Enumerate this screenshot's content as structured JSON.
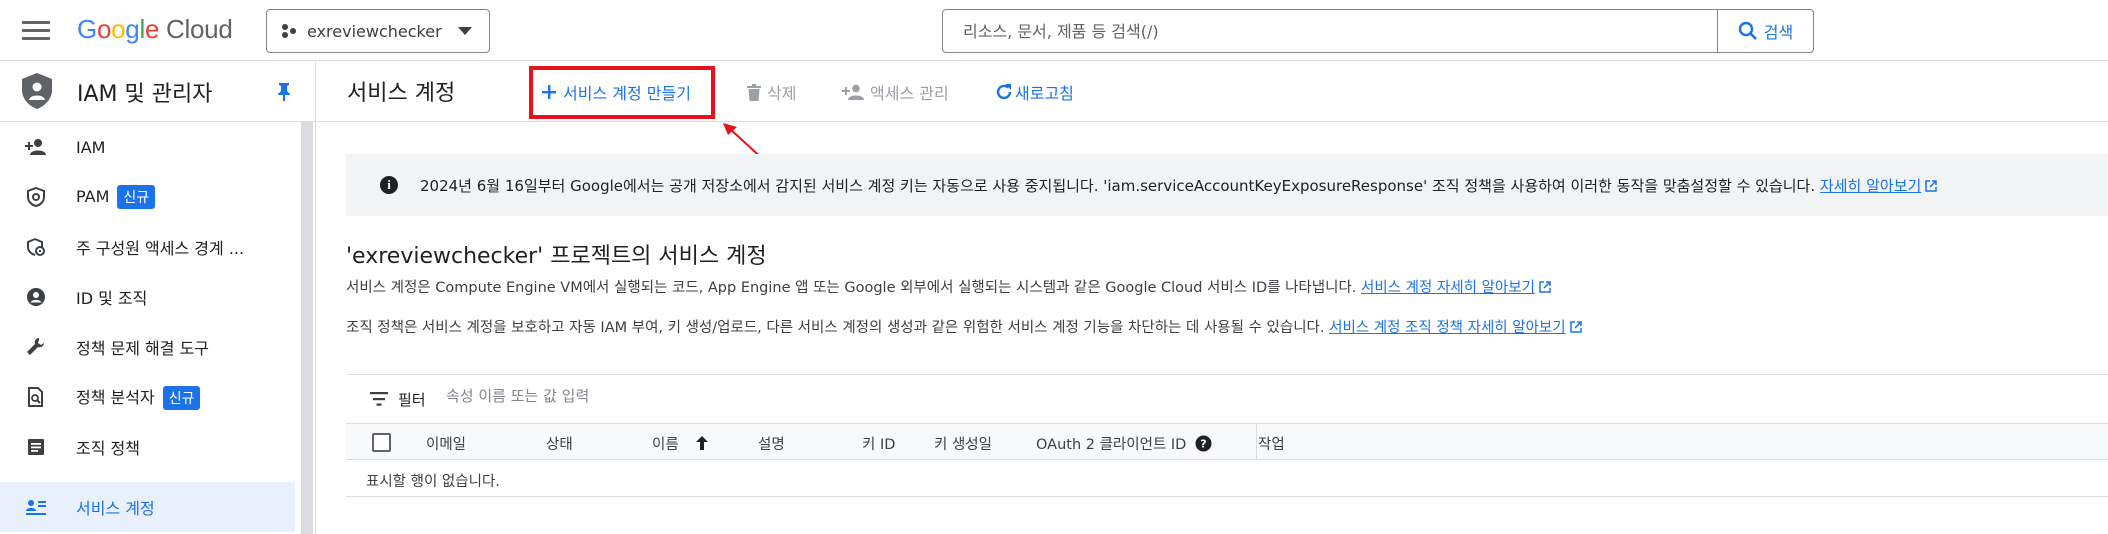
{
  "topbar": {
    "logo_google": "Google",
    "logo_cloud": "Cloud",
    "project_name": "exreviewchecker",
    "search_placeholder": "리소스, 문서, 제품 등 검색(/)",
    "search_button": "검색"
  },
  "product": {
    "title": "IAM 및 관리자"
  },
  "sidebar": {
    "items": [
      {
        "label": "IAM",
        "icon": "person-add-icon",
        "badge": ""
      },
      {
        "label": "PAM",
        "icon": "shield-gear-icon",
        "badge": "신규"
      },
      {
        "label": "주 구성원 액세스 경계 ...",
        "icon": "boundary-icon",
        "badge": ""
      },
      {
        "label": "ID 및 조직",
        "icon": "account-circle-icon",
        "badge": ""
      },
      {
        "label": "정책 문제 해결 도구",
        "icon": "wrench-icon",
        "badge": ""
      },
      {
        "label": "정책 분석자",
        "icon": "document-search-icon",
        "badge": "신규"
      },
      {
        "label": "조직 정책",
        "icon": "list-document-icon",
        "badge": ""
      },
      {
        "label": "서비스 계정",
        "icon": "service-account-icon",
        "badge": "",
        "active": true
      }
    ]
  },
  "toolbar": {
    "page_title": "서비스 계정",
    "create_label": "서비스 계정 만들기",
    "delete_label": "삭제",
    "access_label": "액세스 관리",
    "refresh_label": "새로고침"
  },
  "banner": {
    "text": "2024년 6월 16일부터 Google에서는 공개 저장소에서 감지된 서비스 계정 키는 자동으로 사용 중지됩니다. 'iam.serviceAccountKeyExposureResponse' 조직 정책을 사용하여 이러한 동작을 맞춤설정할 수 있습니다.",
    "link": "자세히 알아보기"
  },
  "section": {
    "title": "'exreviewchecker' 프로젝트의 서비스 계정",
    "desc1": "서비스 계정은 Compute Engine VM에서 실행되는 코드, App Engine 앱 또는 Google 외부에서 실행되는 시스템과 같은 Google Cloud 서비스 ID를 나타냅니다.",
    "desc1_link": "서비스 계정 자세히 알아보기",
    "desc2": "조직 정책은 서비스 계정을 보호하고 자동 IAM 부여, 키 생성/업로드, 다른 서비스 계정의 생성과 같은 위험한 서비스 계정 기능을 차단하는 데 사용될 수 있습니다.",
    "desc2_link": "서비스 계정 조직 정책 자세히 알아보기"
  },
  "filter": {
    "label": "필터",
    "placeholder": "속성 이름 또는 값 입력"
  },
  "table": {
    "columns": [
      "이메일",
      "상태",
      "이름",
      "설명",
      "키 ID",
      "키 생성일",
      "OAuth 2 클라이언트 ID",
      "작업"
    ],
    "empty_text": "표시할 행이 없습니다."
  },
  "colors": {
    "accent": "#1a73e8",
    "highlight": "#e8121e",
    "active_bg": "#e8f0fe"
  }
}
